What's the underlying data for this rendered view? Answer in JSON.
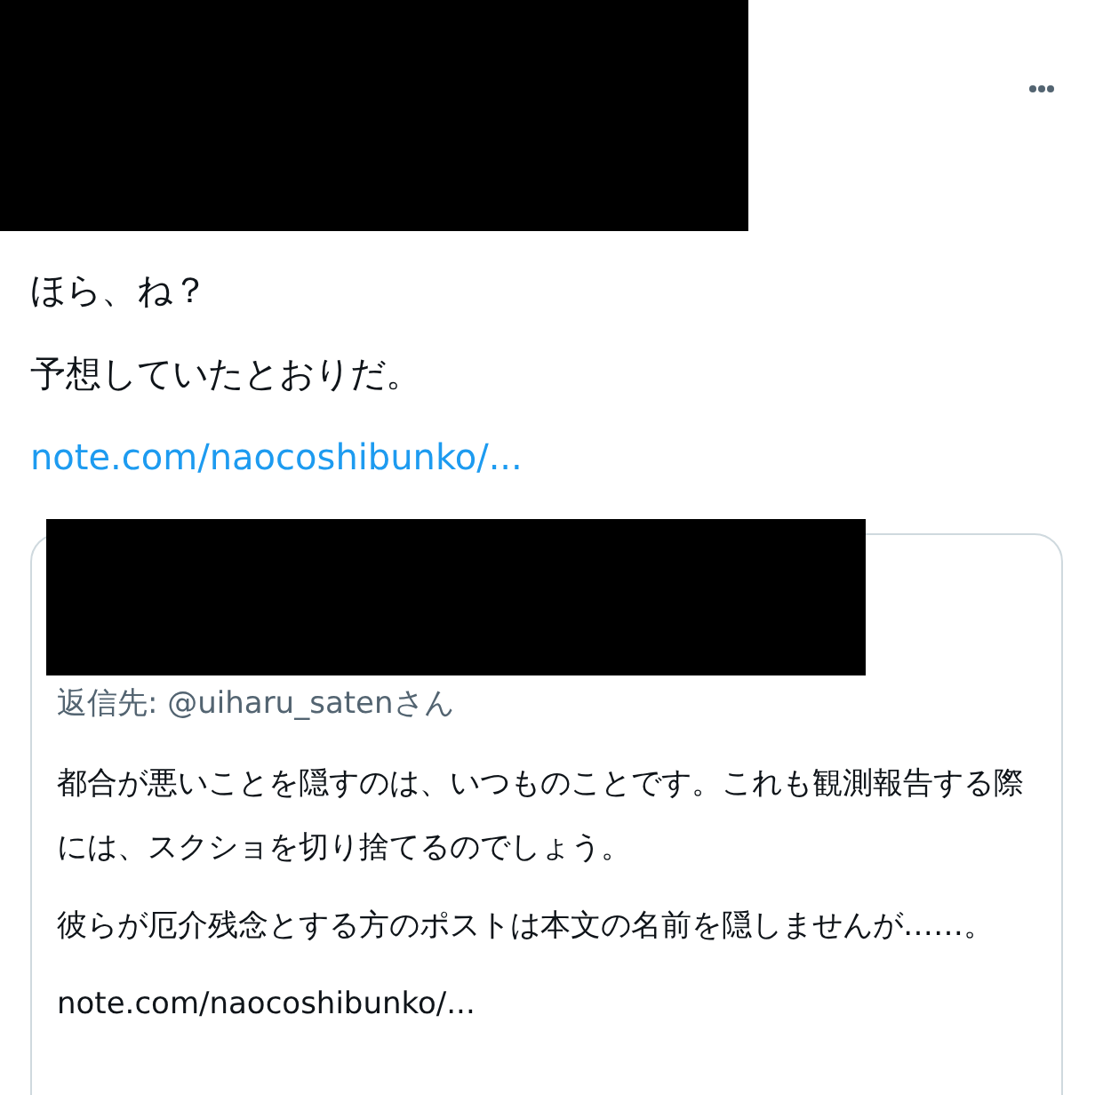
{
  "tweet": {
    "lines": [
      "ほら、ね？",
      "予想していたとおりだ。"
    ],
    "link": "note.com/naocoshibunko/..."
  },
  "quoted_tweet": {
    "reply_to": "返信先: @uiharu_satenさん",
    "paragraphs": [
      "都合が悪いことを隠すのは、いつものことです。これも観測報告する際には、スクショを切り捨てるのでしょう。",
      "彼らが厄介残念とする方のポストは本文の名前を隠しませんが……。",
      "note.com/naocoshibunko/..."
    ]
  }
}
